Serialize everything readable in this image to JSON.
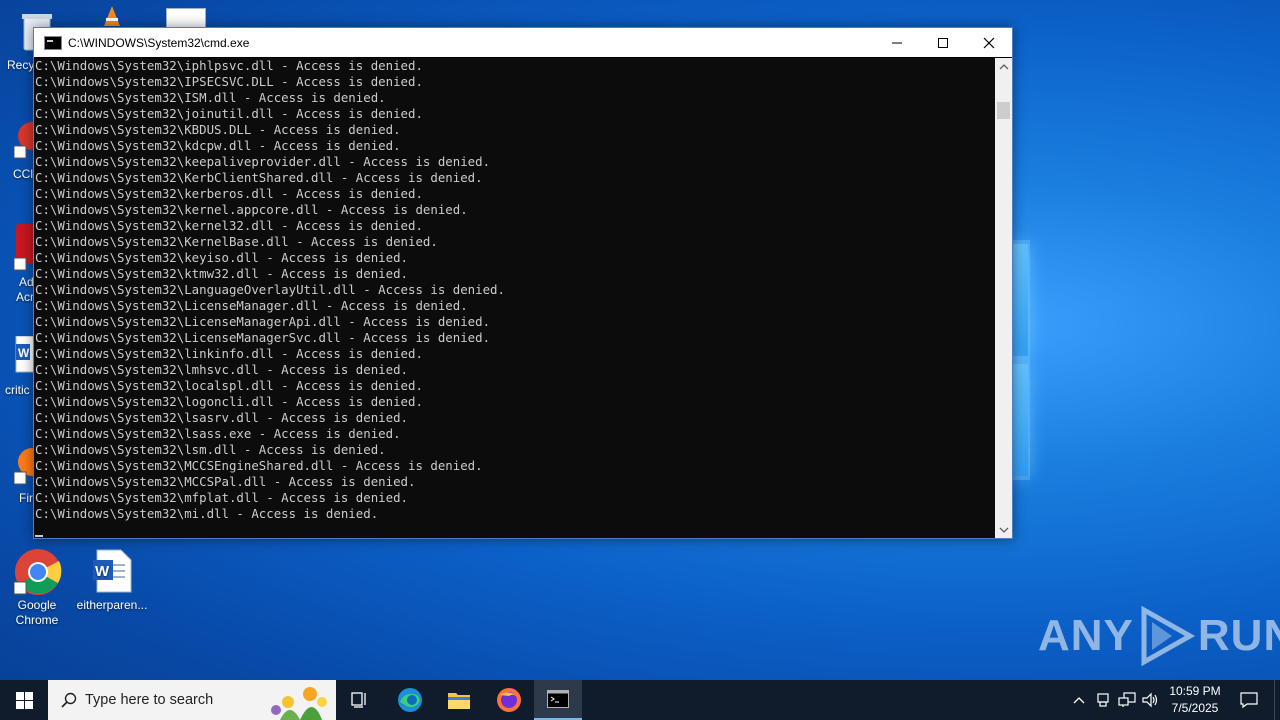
{
  "desktop": {
    "partial_labels": [
      "Recy",
      "CCl",
      "Ad",
      "Acr",
      "critic",
      "Fir"
    ],
    "icons": [
      {
        "label": "Google Chrome",
        "label_line1": "Google",
        "label_line2": "Chrome"
      },
      {
        "label": "eitherparen..."
      }
    ]
  },
  "cmd_window": {
    "title": "C:\\WINDOWS\\System32\\cmd.exe",
    "minimize_glyph": "—",
    "maximize_glyph": "☐",
    "close_glyph": "✕",
    "lines": [
      "C:\\Windows\\System32\\iphlpsvc.dll - Access is denied.",
      "C:\\Windows\\System32\\IPSECSVC.DLL - Access is denied.",
      "C:\\Windows\\System32\\ISM.dll - Access is denied.",
      "C:\\Windows\\System32\\joinutil.dll - Access is denied.",
      "C:\\Windows\\System32\\KBDUS.DLL - Access is denied.",
      "C:\\Windows\\System32\\kdcpw.dll - Access is denied.",
      "C:\\Windows\\System32\\keepaliveprovider.dll - Access is denied.",
      "C:\\Windows\\System32\\KerbClientShared.dll - Access is denied.",
      "C:\\Windows\\System32\\kerberos.dll - Access is denied.",
      "C:\\Windows\\System32\\kernel.appcore.dll - Access is denied.",
      "C:\\Windows\\System32\\kernel32.dll - Access is denied.",
      "C:\\Windows\\System32\\KernelBase.dll - Access is denied.",
      "C:\\Windows\\System32\\keyiso.dll - Access is denied.",
      "C:\\Windows\\System32\\ktmw32.dll - Access is denied.",
      "C:\\Windows\\System32\\LanguageOverlayUtil.dll - Access is denied.",
      "C:\\Windows\\System32\\LicenseManager.dll - Access is denied.",
      "C:\\Windows\\System32\\LicenseManagerApi.dll - Access is denied.",
      "C:\\Windows\\System32\\LicenseManagerSvc.dll - Access is denied.",
      "C:\\Windows\\System32\\linkinfo.dll - Access is denied.",
      "C:\\Windows\\System32\\lmhsvc.dll - Access is denied.",
      "C:\\Windows\\System32\\localspl.dll - Access is denied.",
      "C:\\Windows\\System32\\logoncli.dll - Access is denied.",
      "C:\\Windows\\System32\\lsasrv.dll - Access is denied.",
      "C:\\Windows\\System32\\lsass.exe - Access is denied.",
      "C:\\Windows\\System32\\lsm.dll - Access is denied.",
      "C:\\Windows\\System32\\MCCSEngineShared.dll - Access is denied.",
      "C:\\Windows\\System32\\MCCSPal.dll - Access is denied.",
      "C:\\Windows\\System32\\mfplat.dll - Access is denied.",
      "C:\\Windows\\System32\\mi.dll - Access is denied."
    ]
  },
  "taskbar": {
    "search_placeholder": "Type here to search",
    "apps": [
      "task-view",
      "microsoft-edge",
      "file-explorer",
      "firefox",
      "command-prompt"
    ],
    "active_app": "command-prompt",
    "clock_time": "10:59 PM",
    "clock_date": "7/5/2025"
  },
  "watermark": {
    "left": "ANY",
    "right": "RUN"
  },
  "colors": {
    "desktop_blue": "#0b5fc7",
    "console_bg": "#0c0c0c",
    "console_text": "#cccccc",
    "taskbar_bg": "#101c2c"
  }
}
